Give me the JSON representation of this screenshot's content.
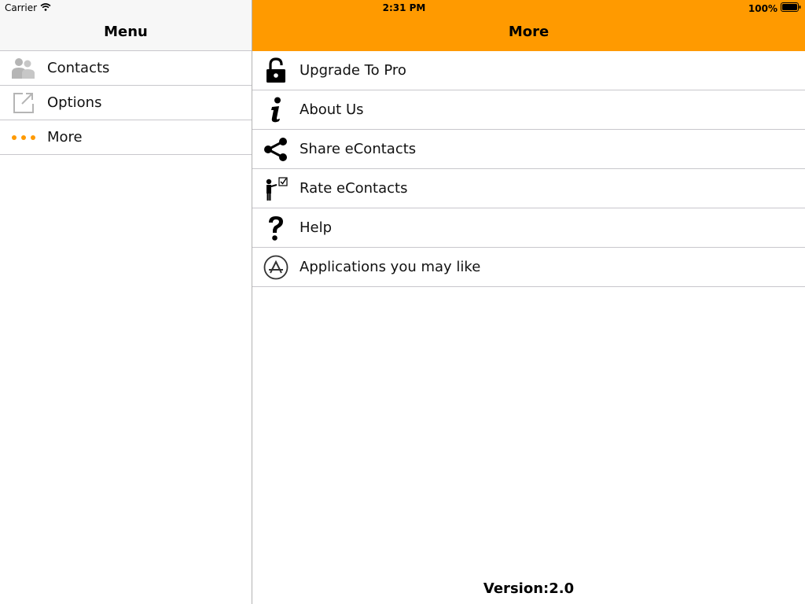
{
  "status_bar": {
    "carrier": "Carrier",
    "time": "2:31 PM",
    "battery": "100%"
  },
  "menu": {
    "title": "Menu",
    "items": [
      {
        "label": "Contacts",
        "icon": "contacts-icon"
      },
      {
        "label": "Options",
        "icon": "options-icon"
      },
      {
        "label": "More",
        "icon": "more-dots-icon",
        "selected": true
      }
    ]
  },
  "detail": {
    "title": "More",
    "items": [
      {
        "label": "Upgrade To Pro",
        "icon": "unlock-icon"
      },
      {
        "label": "About Us",
        "icon": "info-icon"
      },
      {
        "label": "Share eContacts",
        "icon": "share-icon"
      },
      {
        "label": "Rate eContacts",
        "icon": "rate-icon"
      },
      {
        "label": "Help",
        "icon": "question-icon"
      },
      {
        "label": "Applications you may like",
        "icon": "app-store-icon"
      }
    ],
    "version": "Version:2.0"
  },
  "colors": {
    "accent": "#ff9a00",
    "left_header": "#f7f7f7",
    "separator": "#c8c7cc",
    "icon_gray": "#b5b5b5"
  }
}
